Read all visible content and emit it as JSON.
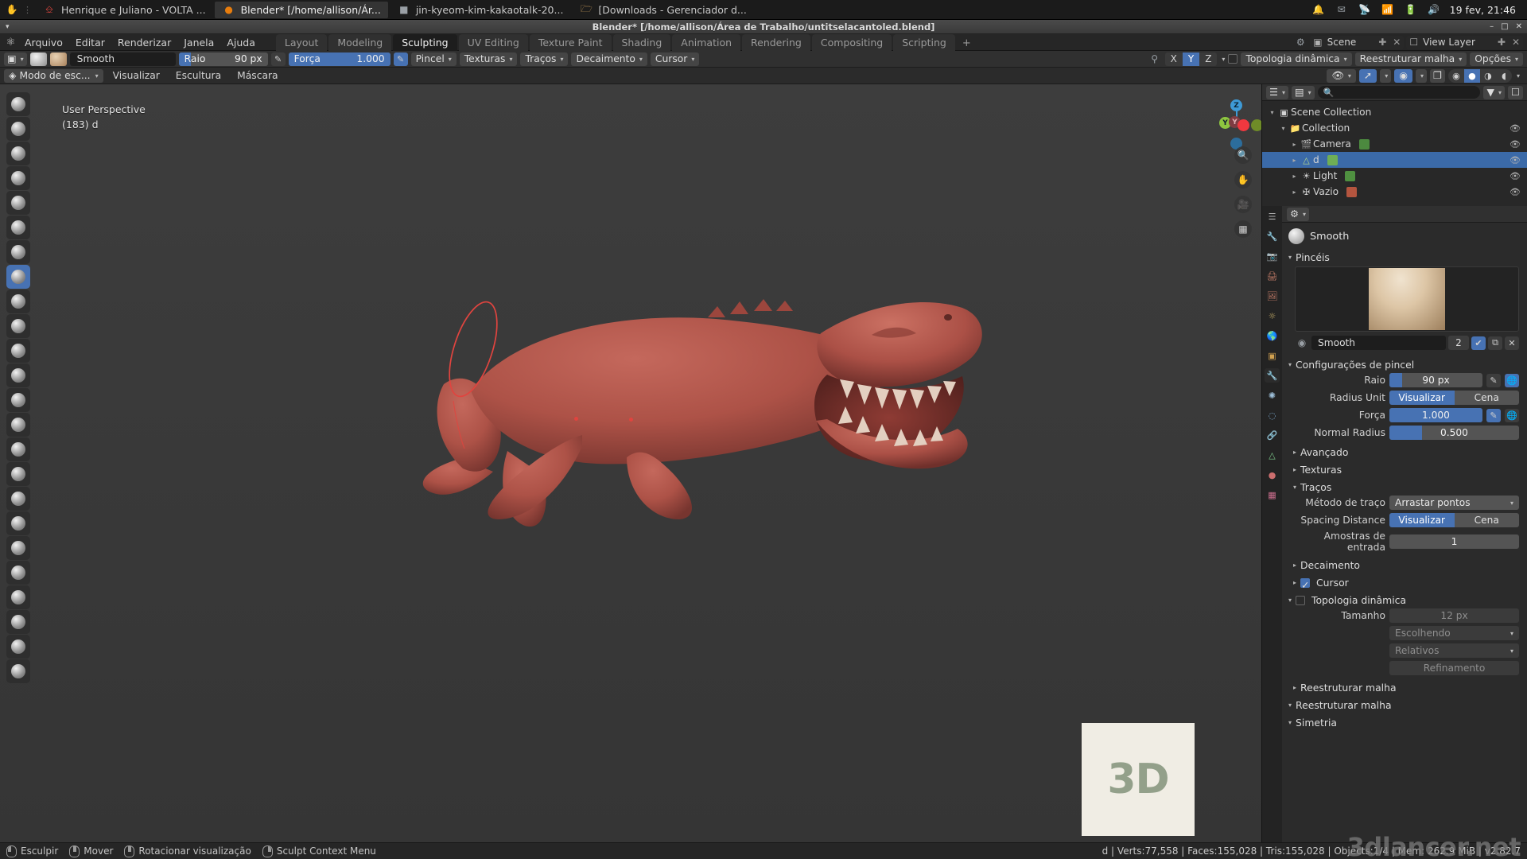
{
  "taskbar": {
    "apps": [
      {
        "label": "Henrique e Juliano - VOLTA ...",
        "icon": "opera-icon",
        "active": false
      },
      {
        "label": "Blender* [/home/allison/Ár...",
        "icon": "blender-icon",
        "active": true
      },
      {
        "label": "jin-kyeom-kim-kakaotalk-20...",
        "icon": "image-viewer-icon",
        "active": false
      },
      {
        "label": "[Downloads - Gerenciador d...",
        "icon": "file-manager-icon",
        "active": false
      }
    ],
    "tray": [
      "bell-icon",
      "mail-icon",
      "bluetooth-icon",
      "wifi-icon",
      "battery-icon",
      "volume-icon"
    ],
    "clock": "19 fev, 21:46"
  },
  "window": {
    "title": "Blender* [/home/allison/Área de Trabalho/untitselacantoled.blend]"
  },
  "topbar": {
    "menus": [
      "Arquivo",
      "Editar",
      "Renderizar",
      "Janela",
      "Ajuda"
    ],
    "workspaces": [
      {
        "label": "Layout",
        "active": false
      },
      {
        "label": "Modeling",
        "active": false
      },
      {
        "label": "Sculpting",
        "active": true
      },
      {
        "label": "UV Editing",
        "active": false
      },
      {
        "label": "Texture Paint",
        "active": false
      },
      {
        "label": "Shading",
        "active": false
      },
      {
        "label": "Animation",
        "active": false
      },
      {
        "label": "Rendering",
        "active": false
      },
      {
        "label": "Compositing",
        "active": false
      },
      {
        "label": "Scripting",
        "active": false
      }
    ],
    "add_workspace": "+",
    "scene_name": "Scene",
    "view_layer_name": "View Layer"
  },
  "tool_header": {
    "brush_name": "Smooth",
    "radius_label": "Raio",
    "radius_value": "90 px",
    "radius_fill_pct": 14,
    "strength_label": "Força",
    "strength_value": "1.000",
    "strength_fill_pct": 100,
    "menus": [
      "Pincel",
      "Texturas",
      "Traços",
      "Decaimento",
      "Cursor"
    ],
    "symmetry_axes": [
      {
        "label": "X",
        "on": false
      },
      {
        "label": "Y",
        "on": true
      },
      {
        "label": "Z",
        "on": false
      }
    ],
    "dyntopo_label": "Topologia dinâmica",
    "dyntopo_enabled": false,
    "remesh_label": "Reestruturar malha",
    "options_label": "Opções"
  },
  "mode_header": {
    "mode": "Modo de esc...",
    "menus": [
      "Visualizar",
      "Escultura",
      "Máscara"
    ]
  },
  "viewport": {
    "perspective_label": "User Perspective",
    "object_info": "(183) d",
    "gizmo_axes": [
      "X",
      "Y",
      "Z"
    ]
  },
  "outliner": {
    "header_title": "Scene Collection",
    "search_placeholder": "",
    "rows": [
      {
        "label": "Collection",
        "icon": "collection-icon",
        "depth": 1,
        "selected": false,
        "expandable": true
      },
      {
        "label": "Camera",
        "icon": "camera-icon",
        "depth": 2,
        "selected": false,
        "expandable": true,
        "badge": "#4c8a3f"
      },
      {
        "label": "d",
        "icon": "mesh-icon",
        "depth": 2,
        "selected": true,
        "expandable": true,
        "badge": "#5aa05a"
      },
      {
        "label": "Light",
        "icon": "light-icon",
        "depth": 2,
        "selected": false,
        "expandable": true,
        "badge": "#3f7a3f"
      },
      {
        "label": "Vazio",
        "icon": "empty-icon",
        "depth": 2,
        "selected": false,
        "expandable": true,
        "badge": "#b4553f"
      }
    ]
  },
  "properties": {
    "brush_title": "Smooth",
    "sections": {
      "brushes": "Pincéis",
      "brush_settings": "Configurações de pincel",
      "advanced": "Avançado",
      "textures": "Texturas",
      "strokes": "Traços",
      "falloff": "Decaimento",
      "cursor": "Cursor",
      "dyntopo": "Topologia dinâmica",
      "remesh": "Reestruturar malha",
      "symmetry": "Simetria"
    },
    "brush_list_name": "Smooth",
    "brush_users": "2",
    "fields": [
      {
        "label": "Raio",
        "value": "90 px",
        "type": "slider",
        "fill_pct": 14
      },
      {
        "label": "Radius Unit",
        "type": "toggle",
        "options": [
          "Visualizar",
          "Cena"
        ],
        "selected": 0
      },
      {
        "label": "Força",
        "value": "1.000",
        "type": "slider",
        "fill_pct": 100
      },
      {
        "label": "Normal Radius",
        "value": "0.500",
        "type": "slider",
        "fill_pct": 25
      }
    ],
    "stroke_fields": [
      {
        "label": "Método de traço",
        "value": "Arrastar pontos",
        "type": "dropdown"
      },
      {
        "label": "Spacing Distance",
        "type": "toggle",
        "options": [
          "Visualizar",
          "Cena"
        ],
        "selected": 0
      },
      {
        "label": "Amostras de entrada",
        "value": "1",
        "type": "field"
      }
    ],
    "dyntopo_fields": [
      {
        "label": "Tamanho",
        "value": "12 px",
        "type": "field"
      },
      {
        "label": "",
        "value": "Escolhendo",
        "type": "dropdown"
      },
      {
        "label": "",
        "value": "Relativos",
        "type": "dropdown"
      },
      {
        "label": "",
        "value": "Refinamento",
        "type": "field"
      }
    ],
    "cursor_checked": true,
    "dyntopo_checked": false
  },
  "statusbar": {
    "actions": [
      {
        "mouse": "left",
        "label": "Esculpir"
      },
      {
        "mouse": "middle",
        "label": "Mover"
      },
      {
        "mouse": "middle2",
        "label": "Rotacionar visualização"
      },
      {
        "mouse": "right",
        "label": "Sculpt Context Menu"
      }
    ],
    "stats": "d | Verts:77,558 | Faces:155,028 | Tris:155,028 | Objects:1/4 | Mem: 262.9 MiB | v2.82.7"
  },
  "watermark": {
    "logo": "3D",
    "site": "3dlancer.net"
  },
  "colors": {
    "accent_blue": "#4772b3",
    "selection_blue": "#3b6aa8",
    "sculpt_red": "#b5544a",
    "stroke_red": "#e0443f"
  }
}
